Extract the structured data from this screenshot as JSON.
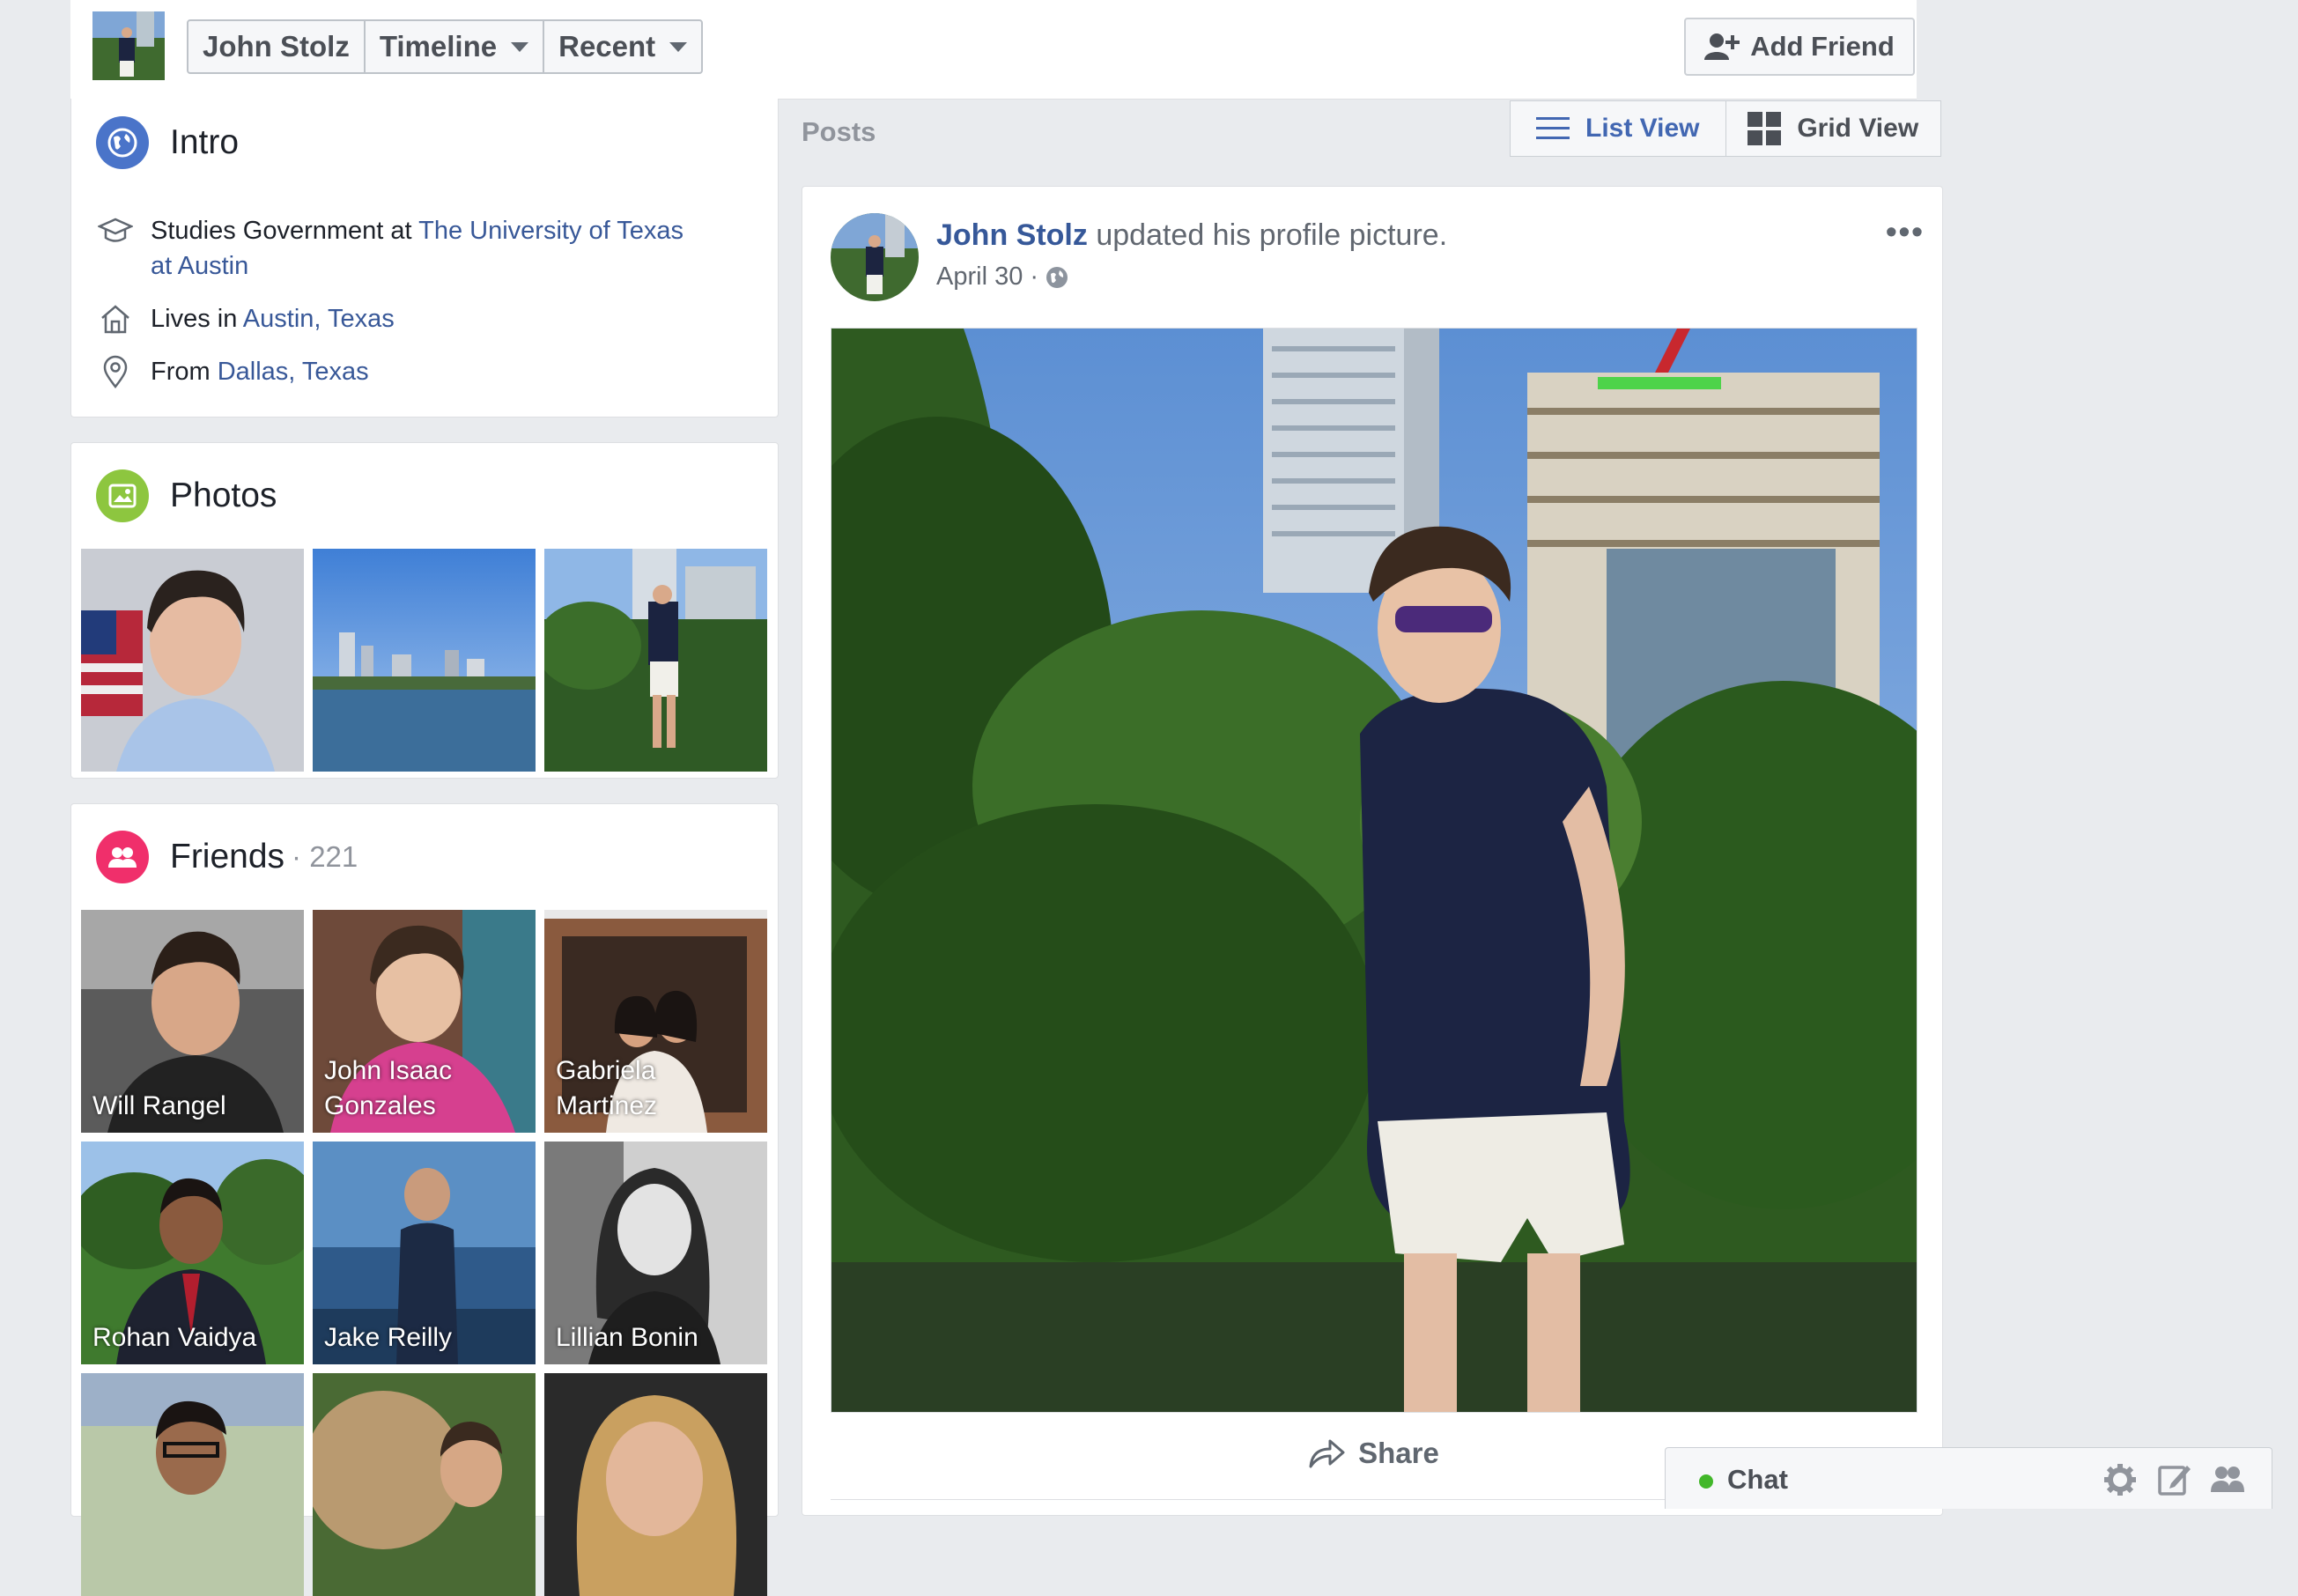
{
  "header": {
    "profile_name": "John Stolz",
    "timeline_label": "Timeline",
    "recent_label": "Recent",
    "add_friend_label": "Add Friend"
  },
  "intro": {
    "title": "Intro",
    "studies_prefix": "Studies Government at ",
    "school_line1": "The University of Texas",
    "school_line2": "at Austin",
    "lives_prefix": "Lives in ",
    "lives_city": "Austin, Texas",
    "from_prefix": "From ",
    "from_city": "Dallas, Texas"
  },
  "photos": {
    "title": "Photos"
  },
  "friends": {
    "title": "Friends",
    "count": "· 221",
    "items": [
      {
        "name": "Will Rangel"
      },
      {
        "name": "John Isaac Gonzales"
      },
      {
        "name": "Gabriela Martinez"
      },
      {
        "name": "Rohan Vaidya"
      },
      {
        "name": "Jake Reilly"
      },
      {
        "name": "Lillian Bonin"
      }
    ]
  },
  "posts": {
    "label": "Posts",
    "list_view_label": "List View",
    "grid_view_label": "Grid View"
  },
  "post": {
    "author": "John Stolz",
    "action": " updated his profile picture.",
    "date": "April 30",
    "date_sep": " · ",
    "more": "•••",
    "share_label": "Share"
  },
  "chat": {
    "label": "Chat"
  },
  "colors": {
    "link": "#385898",
    "accent": "#4267b2",
    "background": "#e9ebee",
    "online": "#42b72a"
  }
}
